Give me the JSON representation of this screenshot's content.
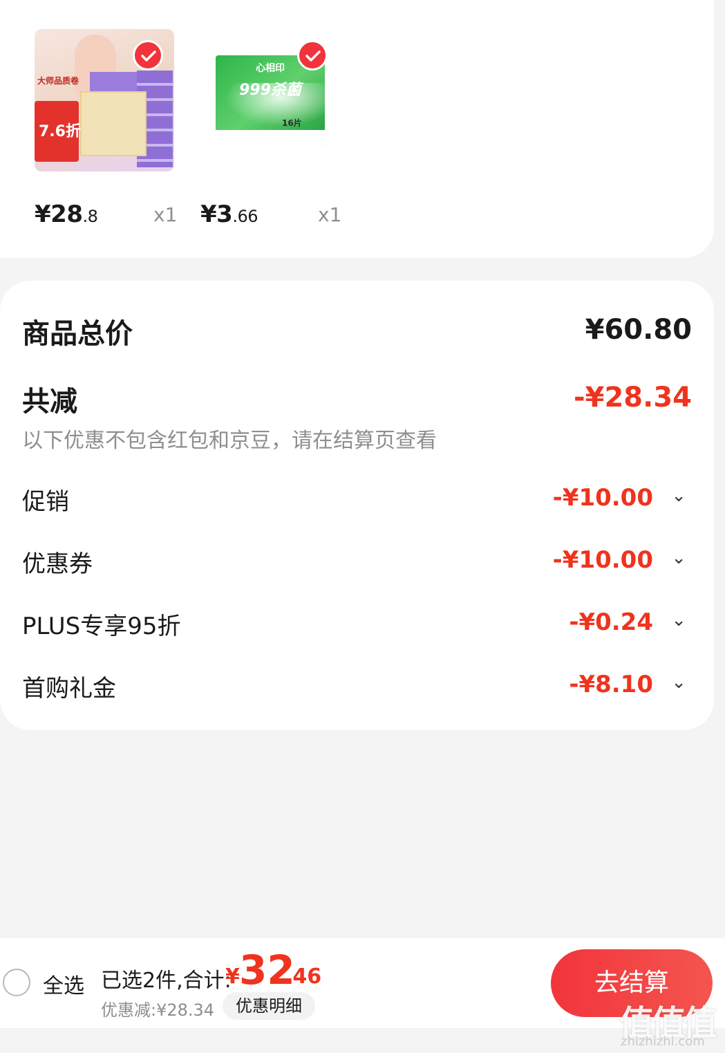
{
  "products": [
    {
      "price_int": "¥28",
      "price_dec": ".8",
      "qty": "x1",
      "image": "tissue-box-pack",
      "image_text": {
        "tag": "大师品质卷",
        "sale": "7.6折"
      }
    },
    {
      "price_int": "¥3",
      "price_dec": ".66",
      "qty": "x1",
      "image": "antibacterial-wipes-pack",
      "image_text": {
        "brand": "心相印",
        "headline": "999杀菌",
        "count": "16片"
      }
    }
  ],
  "summary": {
    "total_label": "商品总价",
    "total_value": "¥60.80",
    "reduction_label": "共减",
    "reduction_value": "-¥28.34",
    "note": "以下优惠不包含红包和京豆，请在结算页查看",
    "items": [
      {
        "label": "促销",
        "value": "-¥10.00"
      },
      {
        "label": "优惠券",
        "value": "-¥10.00"
      },
      {
        "label": "PLUS专享95折",
        "value": "-¥0.24"
      },
      {
        "label": "首购礼金",
        "value": "-¥8.10"
      }
    ]
  },
  "bottom_bar": {
    "select_all": "全选",
    "selected_text": "已选2件,合计:",
    "currency": "¥",
    "total_int": "32",
    "total_dec": ".46",
    "discount_text": "优惠减:¥28.34",
    "detail_button": "优惠明细",
    "checkout_button": "去结算"
  },
  "watermark": {
    "mark": "值值值",
    "url": "zhizhizhi.com"
  },
  "colors": {
    "accent": "#f0331e",
    "checkout": "#f2353b",
    "background": "#f4f4f4"
  },
  "icons": {
    "check": "check-circle-icon",
    "chevron": "chevron-down-icon",
    "radio": "radio-unchecked-icon"
  }
}
